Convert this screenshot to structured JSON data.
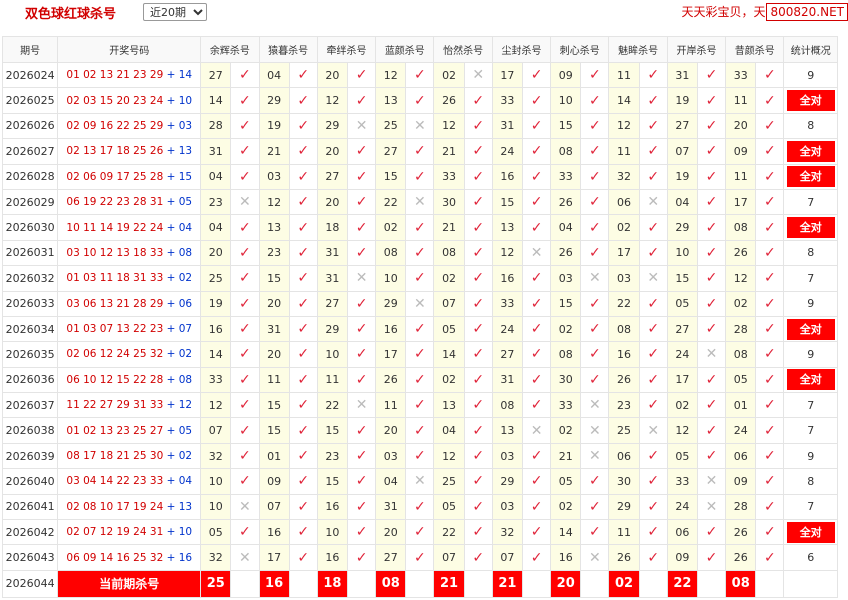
{
  "page": {
    "title": "双色球红球杀号",
    "period_selected": "近20期",
    "brand_text": "天天彩宝贝，天",
    "brand_url": "800820.NET"
  },
  "columns": [
    "期号",
    "开奖号码",
    "余辉杀号",
    "猿暮杀号",
    "牵绊杀号",
    "蓝颜杀号",
    "怡然杀号",
    "尘封杀号",
    "刺心杀号",
    "魅眸杀号",
    "开岸杀号",
    "昔颜杀号",
    "统计概况"
  ],
  "icons": {
    "hit": "check-icon",
    "miss": "cross-icon"
  },
  "colors": {
    "accent": "#ff0000",
    "red_balls": "#d10000",
    "blue_ball": "#0033cc",
    "kill_cell_bg": "#fdfde4"
  },
  "rows": [
    {
      "issue": "2026024",
      "red": "01 02 13 21 23 29",
      "blue": "14",
      "kills": [
        [
          "27",
          1
        ],
        [
          "04",
          1
        ],
        [
          "20",
          1
        ],
        [
          "12",
          1
        ],
        [
          "02",
          0
        ],
        [
          "17",
          1
        ],
        [
          "09",
          1
        ],
        [
          "11",
          1
        ],
        [
          "31",
          1
        ],
        [
          "33",
          1
        ]
      ],
      "summary": "9"
    },
    {
      "issue": "2026025",
      "red": "02 03 15 20 23 24",
      "blue": "10",
      "kills": [
        [
          "14",
          1
        ],
        [
          "29",
          1
        ],
        [
          "12",
          1
        ],
        [
          "13",
          1
        ],
        [
          "26",
          1
        ],
        [
          "33",
          1
        ],
        [
          "10",
          1
        ],
        [
          "14",
          1
        ],
        [
          "19",
          1
        ],
        [
          "11",
          1
        ]
      ],
      "summary": "全对"
    },
    {
      "issue": "2026026",
      "red": "02 09 16 22 25 29",
      "blue": "03",
      "kills": [
        [
          "28",
          1
        ],
        [
          "19",
          1
        ],
        [
          "29",
          0
        ],
        [
          "25",
          0
        ],
        [
          "12",
          1
        ],
        [
          "31",
          1
        ],
        [
          "15",
          1
        ],
        [
          "12",
          1
        ],
        [
          "27",
          1
        ],
        [
          "20",
          1
        ]
      ],
      "summary": "8"
    },
    {
      "issue": "2026027",
      "red": "02 13 17 18 25 26",
      "blue": "13",
      "kills": [
        [
          "31",
          1
        ],
        [
          "21",
          1
        ],
        [
          "20",
          1
        ],
        [
          "27",
          1
        ],
        [
          "21",
          1
        ],
        [
          "24",
          1
        ],
        [
          "08",
          1
        ],
        [
          "11",
          1
        ],
        [
          "07",
          1
        ],
        [
          "09",
          1
        ]
      ],
      "summary": "全对"
    },
    {
      "issue": "2026028",
      "red": "02 06 09 17 25 28",
      "blue": "15",
      "kills": [
        [
          "04",
          1
        ],
        [
          "03",
          1
        ],
        [
          "27",
          1
        ],
        [
          "15",
          1
        ],
        [
          "33",
          1
        ],
        [
          "16",
          1
        ],
        [
          "33",
          1
        ],
        [
          "32",
          1
        ],
        [
          "19",
          1
        ],
        [
          "11",
          1
        ]
      ],
      "summary": "全对"
    },
    {
      "issue": "2026029",
      "red": "06 19 22 23 28 31",
      "blue": "05",
      "kills": [
        [
          "23",
          0
        ],
        [
          "12",
          1
        ],
        [
          "20",
          1
        ],
        [
          "22",
          0
        ],
        [
          "30",
          1
        ],
        [
          "15",
          1
        ],
        [
          "26",
          1
        ],
        [
          "06",
          0
        ],
        [
          "04",
          1
        ],
        [
          "17",
          1
        ]
      ],
      "summary": "7"
    },
    {
      "issue": "2026030",
      "red": "10 11 14 19 22 24",
      "blue": "04",
      "kills": [
        [
          "04",
          1
        ],
        [
          "13",
          1
        ],
        [
          "18",
          1
        ],
        [
          "02",
          1
        ],
        [
          "21",
          1
        ],
        [
          "13",
          1
        ],
        [
          "04",
          1
        ],
        [
          "02",
          1
        ],
        [
          "29",
          1
        ],
        [
          "08",
          1
        ]
      ],
      "summary": "全对"
    },
    {
      "issue": "2026031",
      "red": "03 10 12 13 18 33",
      "blue": "08",
      "kills": [
        [
          "20",
          1
        ],
        [
          "23",
          1
        ],
        [
          "31",
          1
        ],
        [
          "08",
          1
        ],
        [
          "08",
          1
        ],
        [
          "12",
          0
        ],
        [
          "26",
          1
        ],
        [
          "17",
          1
        ],
        [
          "10",
          1
        ],
        [
          "26",
          1
        ]
      ],
      "summary": "8"
    },
    {
      "issue": "2026032",
      "red": "01 03 11 18 31 33",
      "blue": "02",
      "kills": [
        [
          "25",
          1
        ],
        [
          "15",
          1
        ],
        [
          "31",
          0
        ],
        [
          "10",
          1
        ],
        [
          "02",
          1
        ],
        [
          "16",
          1
        ],
        [
          "03",
          0
        ],
        [
          "03",
          0
        ],
        [
          "15",
          1
        ],
        [
          "12",
          1
        ]
      ],
      "summary": "7"
    },
    {
      "issue": "2026033",
      "red": "03 06 13 21 28 29",
      "blue": "06",
      "kills": [
        [
          "19",
          1
        ],
        [
          "20",
          1
        ],
        [
          "27",
          1
        ],
        [
          "29",
          0
        ],
        [
          "07",
          1
        ],
        [
          "33",
          1
        ],
        [
          "15",
          1
        ],
        [
          "22",
          1
        ],
        [
          "05",
          1
        ],
        [
          "02",
          1
        ]
      ],
      "summary": "9"
    },
    {
      "issue": "2026034",
      "red": "01 03 07 13 22 23",
      "blue": "07",
      "kills": [
        [
          "16",
          1
        ],
        [
          "31",
          1
        ],
        [
          "29",
          1
        ],
        [
          "16",
          1
        ],
        [
          "05",
          1
        ],
        [
          "24",
          1
        ],
        [
          "02",
          1
        ],
        [
          "08",
          1
        ],
        [
          "27",
          1
        ],
        [
          "28",
          1
        ]
      ],
      "summary": "全对"
    },
    {
      "issue": "2026035",
      "red": "02 06 12 24 25 32",
      "blue": "02",
      "kills": [
        [
          "14",
          1
        ],
        [
          "20",
          1
        ],
        [
          "10",
          1
        ],
        [
          "17",
          1
        ],
        [
          "14",
          1
        ],
        [
          "27",
          1
        ],
        [
          "08",
          1
        ],
        [
          "16",
          1
        ],
        [
          "24",
          0
        ],
        [
          "08",
          1
        ]
      ],
      "summary": "9"
    },
    {
      "issue": "2026036",
      "red": "06 10 12 15 22 28",
      "blue": "08",
      "kills": [
        [
          "33",
          1
        ],
        [
          "11",
          1
        ],
        [
          "11",
          1
        ],
        [
          "26",
          1
        ],
        [
          "02",
          1
        ],
        [
          "31",
          1
        ],
        [
          "30",
          1
        ],
        [
          "26",
          1
        ],
        [
          "17",
          1
        ],
        [
          "05",
          1
        ]
      ],
      "summary": "全对"
    },
    {
      "issue": "2026037",
      "red": "11 22 27 29 31 33",
      "blue": "12",
      "kills": [
        [
          "12",
          1
        ],
        [
          "15",
          1
        ],
        [
          "22",
          0
        ],
        [
          "11",
          1
        ],
        [
          "13",
          1
        ],
        [
          "08",
          1
        ],
        [
          "33",
          0
        ],
        [
          "23",
          1
        ],
        [
          "02",
          1
        ],
        [
          "01",
          1
        ]
      ],
      "summary": "7"
    },
    {
      "issue": "2026038",
      "red": "01 02 13 23 25 27",
      "blue": "05",
      "kills": [
        [
          "07",
          1
        ],
        [
          "15",
          1
        ],
        [
          "15",
          1
        ],
        [
          "20",
          1
        ],
        [
          "04",
          1
        ],
        [
          "13",
          0
        ],
        [
          "02",
          0
        ],
        [
          "25",
          0
        ],
        [
          "12",
          1
        ],
        [
          "24",
          1
        ]
      ],
      "summary": "7"
    },
    {
      "issue": "2026039",
      "red": "08 17 18 21 25 30",
      "blue": "02",
      "kills": [
        [
          "32",
          1
        ],
        [
          "01",
          1
        ],
        [
          "23",
          1
        ],
        [
          "03",
          1
        ],
        [
          "12",
          1
        ],
        [
          "03",
          1
        ],
        [
          "21",
          0
        ],
        [
          "06",
          1
        ],
        [
          "05",
          1
        ],
        [
          "06",
          1
        ]
      ],
      "summary": "9"
    },
    {
      "issue": "2026040",
      "red": "03 04 14 22 23 33",
      "blue": "04",
      "kills": [
        [
          "10",
          1
        ],
        [
          "09",
          1
        ],
        [
          "15",
          1
        ],
        [
          "04",
          0
        ],
        [
          "25",
          1
        ],
        [
          "29",
          1
        ],
        [
          "05",
          1
        ],
        [
          "30",
          1
        ],
        [
          "33",
          0
        ],
        [
          "09",
          1
        ]
      ],
      "summary": "8"
    },
    {
      "issue": "2026041",
      "red": "02 08 10 17 19 24",
      "blue": "13",
      "kills": [
        [
          "10",
          0
        ],
        [
          "07",
          1
        ],
        [
          "16",
          1
        ],
        [
          "31",
          1
        ],
        [
          "05",
          1
        ],
        [
          "03",
          1
        ],
        [
          "02",
          1
        ],
        [
          "29",
          1
        ],
        [
          "24",
          0
        ],
        [
          "28",
          1
        ]
      ],
      "summary": "7"
    },
    {
      "issue": "2026042",
      "red": "02 07 12 19 24 31",
      "blue": "10",
      "kills": [
        [
          "05",
          1
        ],
        [
          "16",
          1
        ],
        [
          "10",
          1
        ],
        [
          "20",
          1
        ],
        [
          "22",
          1
        ],
        [
          "32",
          1
        ],
        [
          "14",
          1
        ],
        [
          "11",
          1
        ],
        [
          "06",
          1
        ],
        [
          "26",
          1
        ]
      ],
      "summary": "全对"
    },
    {
      "issue": "2026043",
      "red": "06 09 14 16 25 32",
      "blue": "16",
      "kills": [
        [
          "32",
          0
        ],
        [
          "17",
          1
        ],
        [
          "16",
          1
        ],
        [
          "27",
          1
        ],
        [
          "07",
          1
        ],
        [
          "07",
          1
        ],
        [
          "16",
          0
        ],
        [
          "26",
          1
        ],
        [
          "09",
          1
        ],
        [
          "26",
          1
        ]
      ],
      "summary": "6"
    }
  ],
  "current": {
    "issue": "2026044",
    "label": "当前期杀号",
    "kills": [
      "25",
      "16",
      "18",
      "08",
      "21",
      "21",
      "20",
      "02",
      "22",
      "08"
    ]
  }
}
